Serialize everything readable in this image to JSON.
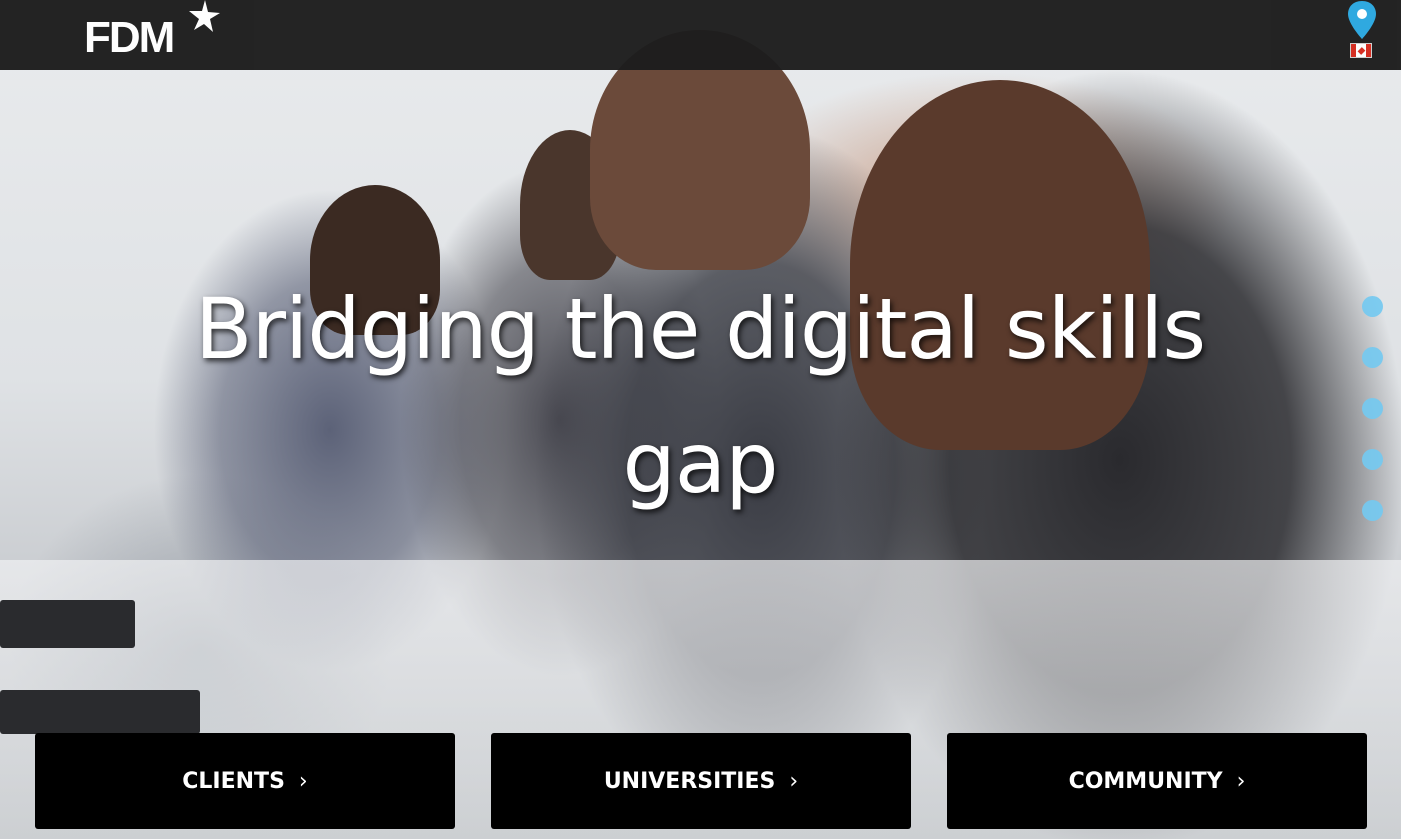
{
  "header": {
    "logo_text": "FDM",
    "location_icon": "map-pin-icon",
    "region_flag": "canada-flag-icon"
  },
  "hero": {
    "headline": "Bridging the digital skills gap",
    "slide_count": 5,
    "active_slide": 1
  },
  "cta_buttons": [
    {
      "label": "CLIENTS",
      "chevron": "›"
    },
    {
      "label": "UNIVERSITIES",
      "chevron": "›"
    },
    {
      "label": "COMMUNITY",
      "chevron": "›"
    }
  ],
  "colors": {
    "topbar": "#1d1d1d",
    "accent_blue": "#74c9f0",
    "cta_bg": "#000000",
    "text": "#ffffff",
    "flag_red": "#d52b1e"
  }
}
